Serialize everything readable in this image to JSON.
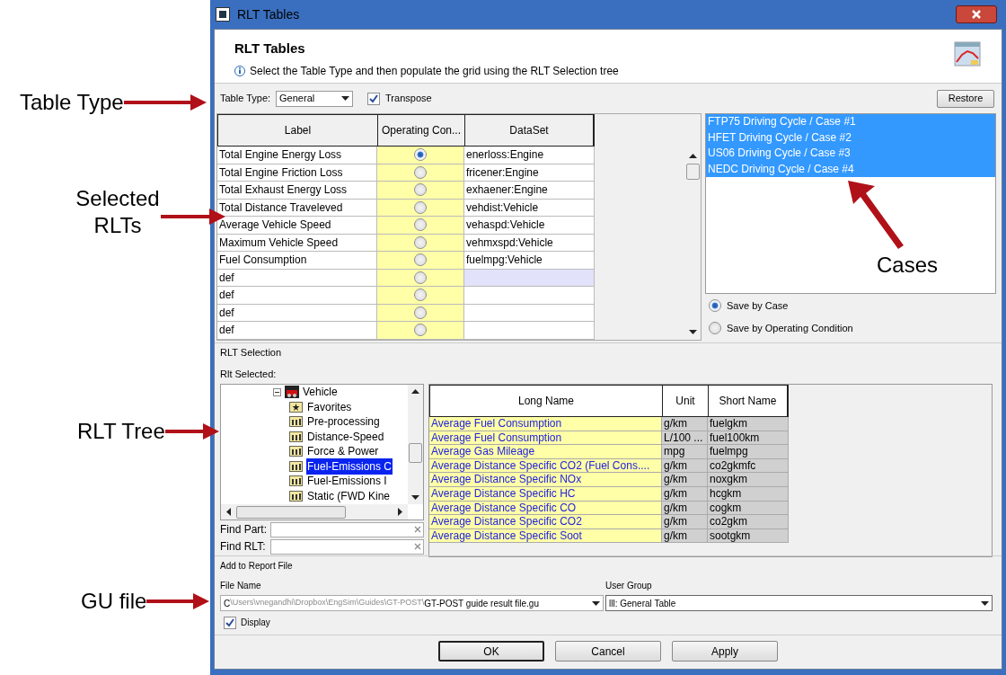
{
  "annotations": [
    {
      "text": "Table Type"
    },
    {
      "text": "Selected RLTs"
    },
    {
      "text": "RLT Tree"
    },
    {
      "text": "GU file"
    },
    {
      "text": "Cases"
    }
  ],
  "window": {
    "title": "RLT Tables"
  },
  "header": {
    "title": "RLT Tables",
    "info": "Select the Table Type and then populate the grid using the RLT Selection tree"
  },
  "toolbar": {
    "table_type_label": "Table Type:",
    "table_type": "General",
    "transpose": {
      "label": "Transpose",
      "checked": true
    },
    "restore": "Restore"
  },
  "grid": {
    "columns": [
      "Label",
      "Operating Con...",
      "DataSet"
    ],
    "rows": [
      {
        "label": "Total Engine Energy Loss",
        "selected": true,
        "dataset": "enerloss:Engine",
        "focused": false
      },
      {
        "label": "Total Engine Friction Loss",
        "selected": false,
        "dataset": "fricener:Engine",
        "focused": false
      },
      {
        "label": "Total Exhaust Energy Loss",
        "selected": false,
        "dataset": "exhaener:Engine",
        "focused": false
      },
      {
        "label": "Total Distance Traveleved",
        "selected": false,
        "dataset": "vehdist:Vehicle",
        "focused": false
      },
      {
        "label": "Average Vehicle Speed",
        "selected": false,
        "dataset": "vehaspd:Vehicle",
        "focused": false
      },
      {
        "label": "Maximum Vehicle Speed",
        "selected": false,
        "dataset": "vehmxspd:Vehicle",
        "focused": false
      },
      {
        "label": "Fuel Consumption",
        "selected": false,
        "dataset": "fuelmpg:Vehicle",
        "focused": false
      },
      {
        "label": "def",
        "selected": false,
        "dataset": "",
        "focused": true
      },
      {
        "label": "def",
        "selected": false,
        "dataset": "",
        "focused": false
      },
      {
        "label": "def",
        "selected": false,
        "dataset": "",
        "focused": false
      },
      {
        "label": "def",
        "selected": false,
        "dataset": "",
        "focused": false
      }
    ]
  },
  "cases": [
    {
      "label": "FTP75 Driving Cycle / Case #1",
      "selected": true
    },
    {
      "label": "HFET Driving Cycle / Case #2",
      "selected": true
    },
    {
      "label": "US06 Driving Cycle / Case #3",
      "selected": true
    },
    {
      "label": "NEDC Driving Cycle / Case #4",
      "selected": true
    }
  ],
  "save_options": [
    {
      "label": "Save by Case",
      "selected": true
    },
    {
      "label": "Save by Operating Condition",
      "selected": false
    }
  ],
  "rlt_selection": {
    "title": "RLT Selection",
    "selected_label": "Rlt Selected:",
    "tree": [
      {
        "label": "Vehicle",
        "expanded": true,
        "children": [
          {
            "label": "Favorites",
            "kind": "favorites",
            "selected": false
          },
          {
            "label": "Pre-processing",
            "kind": "rlt",
            "selected": false
          },
          {
            "label": "Distance-Speed",
            "kind": "rlt",
            "selected": false
          },
          {
            "label": "Force & Power",
            "kind": "rlt",
            "selected": false
          },
          {
            "label": "Fuel-Emissions C",
            "kind": "rlt",
            "selected": true
          },
          {
            "label": "Fuel-Emissions I",
            "kind": "rlt",
            "selected": false
          },
          {
            "label": "Static (FWD Kine",
            "kind": "rlt",
            "selected": false
          }
        ]
      }
    ],
    "find_part": "Find Part:",
    "find_rlt": "Find RLT:",
    "columns": [
      "Long Name",
      "Unit",
      "Short Name"
    ],
    "rows": [
      [
        "Average Fuel Consumption",
        "g/km",
        "fuelgkm"
      ],
      [
        "Average Fuel Consumption",
        "L/100 ...",
        "fuel100km"
      ],
      [
        "Average Gas Mileage",
        "mpg",
        "fuelmpg"
      ],
      [
        "Average Distance Specific CO2 (Fuel Cons....",
        "g/km",
        "co2gkmfc"
      ],
      [
        "Average Distance Specific NOx",
        "g/km",
        "noxgkm"
      ],
      [
        "Average Distance Specific HC",
        "g/km",
        "hcgkm"
      ],
      [
        "Average Distance Specific CO",
        "g/km",
        "cogkm"
      ],
      [
        "Average Distance Specific CO2",
        "g/km",
        "co2gkm"
      ],
      [
        "Average Distance Specific Soot",
        "g/km",
        "sootgkm"
      ]
    ]
  },
  "report": {
    "title": "Add to Report File",
    "file_name_label": "File Name",
    "path_start": "C",
    "path_faded": "\\Users\\vnegandhi\\Dropbox\\EngSim\\Guides\\GT-POST\\",
    "path_end": "GT-POST guide result file.gu",
    "user_group_label": "User Group",
    "user_group": "lll: General Table",
    "display": {
      "label": "Display",
      "checked": true
    }
  },
  "buttons": [
    "OK",
    "Cancel",
    "Apply"
  ]
}
